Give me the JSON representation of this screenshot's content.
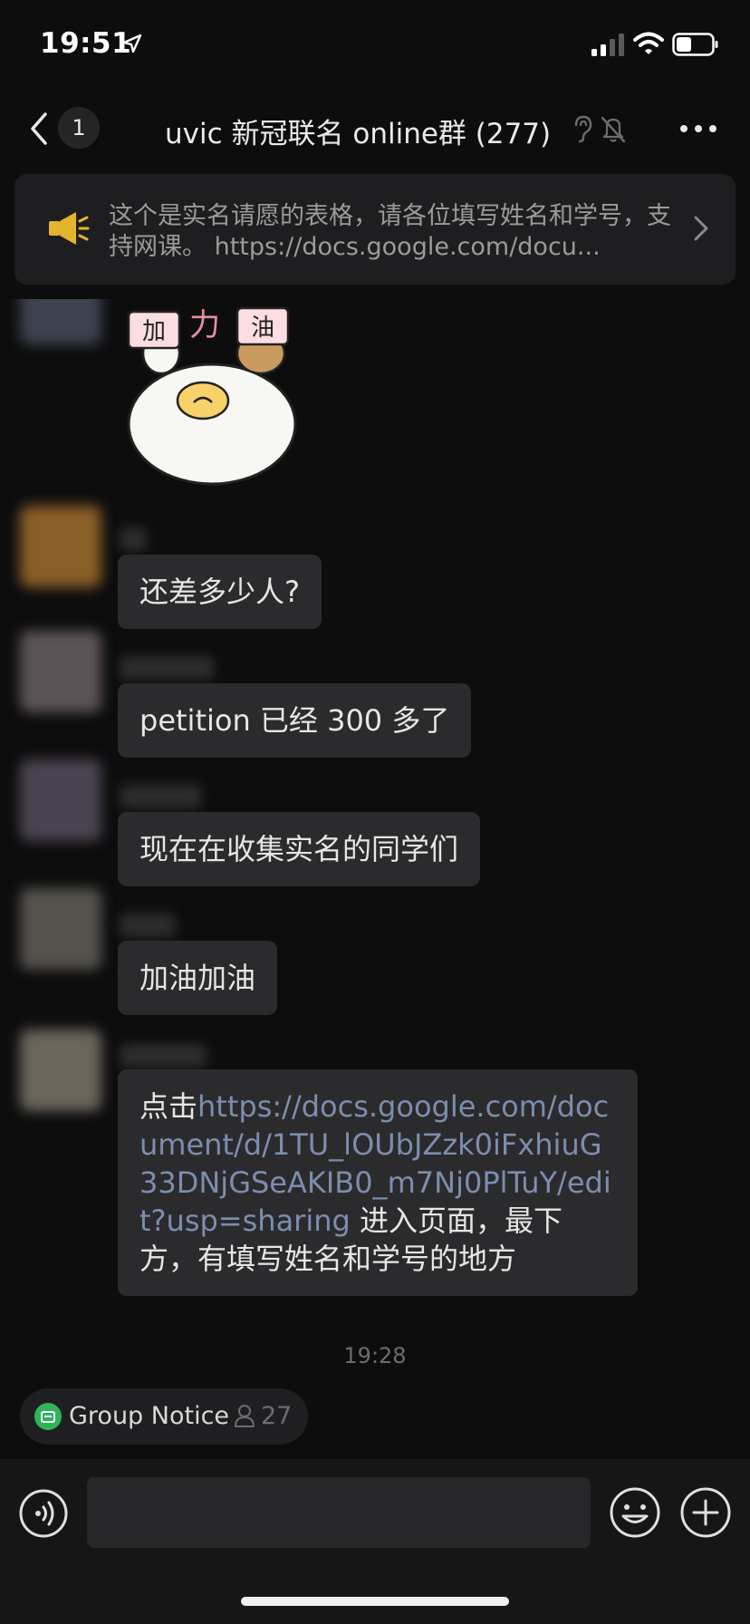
{
  "status_bar": {
    "time": "19:51",
    "icons": [
      "location-arrow-icon",
      "cellular-signal-icon",
      "wifi-icon",
      "battery-icon"
    ]
  },
  "nav": {
    "unread_count": "1",
    "title": "uvic 新冠联名 online群 (277)",
    "icons": [
      "back-chevron-icon",
      "ear-icon",
      "mute-bell-icon",
      "more-dots-icon"
    ]
  },
  "announcement": {
    "text": "这个是实名请愿的表格，请各位填写姓名和学号，支持网课。 https://docs.google.com/docu..."
  },
  "messages": [
    {
      "type": "sticker",
      "sticker_text": [
        "加",
        "力",
        "油"
      ]
    },
    {
      "type": "text",
      "text": "还差多少人?"
    },
    {
      "type": "text",
      "text": "petition 已经 300 多了"
    },
    {
      "type": "text",
      "text": "现在在收集实名的同学们"
    },
    {
      "type": "text",
      "text": "加油加油"
    },
    {
      "type": "link",
      "prefix": "点击",
      "link": "https://docs.google.com/document/d/1TU_lOUbJZzk0iFxhiuG33DNjGSeAKIB0_m7Nj0PlTuY/edit?usp=sharing",
      "suffix": " 进入页面，最下方，有填写姓名和学号的地方"
    }
  ],
  "timestamp": "19:28",
  "group_notice": {
    "label": "Group Notice",
    "count": "27"
  },
  "input": {
    "placeholder": ""
  },
  "colors": {
    "background": "#0d0d0e",
    "bubble": "#2b2b2d",
    "link": "#7d8dad",
    "megaphone": "#e3b52c",
    "notice_green": "#2fb45a"
  }
}
